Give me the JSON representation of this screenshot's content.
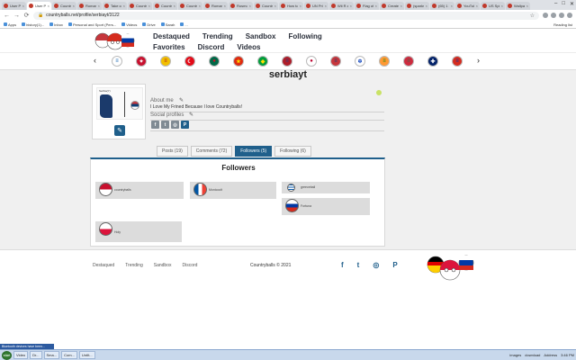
{
  "browser": {
    "tabs": [
      {
        "label": "User Profile"
      },
      {
        "label": "User Profile",
        "active": true
      },
      {
        "label": "Countryballs"
      },
      {
        "label": "Romanian"
      },
      {
        "label": "Take conversat"
      },
      {
        "label": "Countryballs"
      },
      {
        "label": "Country Ba"
      },
      {
        "label": "Countryballs"
      },
      {
        "label": "Romanian"
      },
      {
        "label": "Rosmos Countr"
      },
      {
        "label": "Countryballs"
      },
      {
        "label": "How to draw"
      },
      {
        "label": "UN Printed"
      },
      {
        "label": "Wii R and Wii U"
      },
      {
        "label": "Flag of Sri Lanka"
      },
      {
        "label": "Create"
      },
      {
        "label": "(sparks)"
      },
      {
        "label": "(65) 1 1 Cou"
      },
      {
        "label": "YouTube H"
      },
      {
        "label": "US Spin Wi"
      },
      {
        "label": "Wallpaper"
      }
    ],
    "url": "countryballs.net/profile/serbiayt/3122",
    "bookmarks": [
      "Apps",
      "history(1)...",
      "Inbox",
      "Personal and Sport (Pers...",
      "Videos",
      "Drive",
      "Sarah",
      "..."
    ],
    "bookmarks_right": "Reading list"
  },
  "site": {
    "nav": [
      "Destaqued",
      "Trending",
      "Sandbox",
      "Following",
      "Favorites",
      "Discord",
      "Videos"
    ],
    "prev_arrow": "‹",
    "next_arrow": "›",
    "flags": [
      {
        "color": "#0d5eaf",
        "bg": "#ffffff",
        "glyph": "≡"
      },
      {
        "color": "#ffffff",
        "bg": "#c8102e",
        "glyph": "✦"
      },
      {
        "color": "#aa151b",
        "bg": "#f1bf00",
        "glyph": "≡"
      },
      {
        "color": "#ffffff",
        "bg": "#e30a17",
        "glyph": "☾"
      },
      {
        "color": "#ce1126",
        "bg": "#006847",
        "glyph": "●"
      },
      {
        "color": "#ffde00",
        "bg": "#de2910",
        "glyph": "★"
      },
      {
        "color": "#ffdf00",
        "bg": "#009c3b",
        "glyph": "◆"
      },
      {
        "color": "#21468b",
        "bg": "#ae1c28",
        "glyph": "≡"
      },
      {
        "color": "#bc002d",
        "bg": "#ffffff",
        "glyph": "●"
      },
      {
        "color": "#0c4076",
        "bg": "#c6363c",
        "glyph": "≡"
      },
      {
        "color": "#0038b8",
        "bg": "#ffffff",
        "glyph": "✡"
      },
      {
        "color": "#138808",
        "bg": "#ff9933",
        "glyph": "≡"
      },
      {
        "color": "#436f4d",
        "bg": "#cd2a3e",
        "glyph": "≡"
      },
      {
        "color": "#ffffff",
        "bg": "#012169",
        "glyph": "✚"
      },
      {
        "color": "#0039a6",
        "bg": "#d52b1e",
        "glyph": "≡"
      }
    ]
  },
  "profile": {
    "username": "serbiayt",
    "avatar_caption": "Serbia(Y)",
    "about_label": "About me",
    "about_text": "I Love My Frined Because I love Countryballs!",
    "social_label": "Social profiles",
    "social_icons": [
      "f",
      "t",
      "◎",
      "P"
    ],
    "edit_glyph": "✎"
  },
  "tabs": [
    {
      "label": "Posts (19)",
      "active": false
    },
    {
      "label": "Comments (72)",
      "active": false
    },
    {
      "label": "Followers (5)",
      "active": true
    },
    {
      "label": "Following (6)",
      "active": false
    }
  ],
  "followers": {
    "title": "Followers",
    "items": [
      {
        "name": "countryballs"
      },
      {
        "name": "Monicoolt"
      },
      {
        "name": "greeceball"
      },
      {
        "name": "Fortuna"
      },
      {
        "name": "Holy"
      }
    ]
  },
  "footer": {
    "links": [
      "Destaqued",
      "Trending",
      "Sandbox",
      "Discord"
    ],
    "copyright": "Countryballs © 2021",
    "social": [
      "f",
      "t",
      "◎",
      "P"
    ]
  },
  "taskbar": {
    "start": "start",
    "items": [
      "Video",
      "Dr...",
      "Sma...",
      "Com...",
      "UntIt..."
    ],
    "right_items": [
      "images",
      "download",
      "Address"
    ],
    "clock": "3:46 PM",
    "tooltip": "Bluetooth devices have been..."
  }
}
